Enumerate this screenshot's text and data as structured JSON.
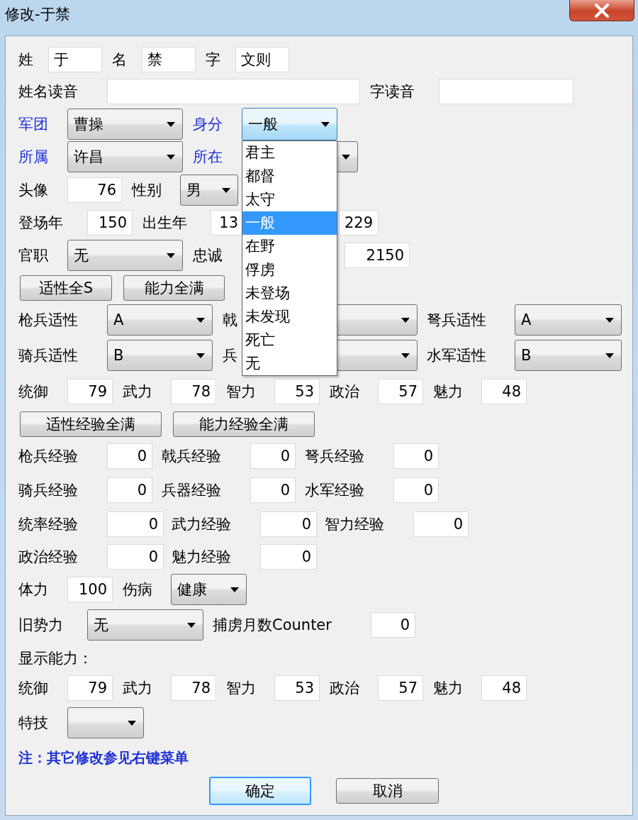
{
  "window": {
    "title": "修改-于禁"
  },
  "rows": [
    {
      "items": [
        {
          "kind": "label",
          "text": "姓"
        },
        {
          "kind": "text",
          "value": "于"
        },
        {
          "kind": "label",
          "text": "名"
        },
        {
          "kind": "text",
          "value": "禁"
        },
        {
          "kind": "label",
          "text": "字"
        },
        {
          "kind": "text",
          "value": "文则"
        }
      ]
    },
    {
      "items": [
        {
          "kind": "label",
          "text": "姓名读音"
        },
        {
          "kind": "text"
        },
        {
          "kind": "label",
          "text": "字读音"
        },
        {
          "kind": "text"
        }
      ]
    },
    {
      "items": [
        {
          "kind": "link",
          "text": "军团"
        },
        {
          "kind": "combo",
          "value": "曹操",
          "open": false
        },
        {
          "kind": "link",
          "text": "身分"
        },
        {
          "kind": "combo",
          "value": "一般",
          "open": true,
          "options": [
            {
              "text": "君主",
              "selected": false
            },
            {
              "text": "都督",
              "selected": false
            },
            {
              "text": "太守",
              "selected": false
            },
            {
              "text": "一般",
              "selected": true
            },
            {
              "text": "在野",
              "selected": false
            },
            {
              "text": "俘虏",
              "selected": false
            },
            {
              "text": "未登场",
              "selected": false
            },
            {
              "text": "未发现",
              "selected": false
            },
            {
              "text": "死亡",
              "selected": false
            },
            {
              "text": "无",
              "selected": false
            }
          ]
        }
      ]
    },
    {
      "items": [
        {
          "kind": "link",
          "text": "所属"
        },
        {
          "kind": "combo",
          "value": "许昌",
          "open": false
        },
        {
          "kind": "link",
          "text": "所在"
        },
        {
          "kind": "combo",
          "open": false
        }
      ]
    },
    {
      "items": [
        {
          "kind": "label",
          "text": "头像"
        },
        {
          "kind": "number",
          "value": "76"
        },
        {
          "kind": "label",
          "text": "性别"
        },
        {
          "kind": "combo",
          "value": "男",
          "open": false
        }
      ]
    },
    {
      "items": [
        {
          "kind": "label",
          "text": "登场年"
        },
        {
          "kind": "number",
          "value": "150"
        },
        {
          "kind": "label",
          "text": "出生年"
        },
        {
          "kind": "number",
          "value": "13"
        },
        {
          "kind": "number",
          "value": "229"
        }
      ]
    },
    {
      "items": [
        {
          "kind": "label",
          "text": "官职"
        },
        {
          "kind": "combo",
          "value": "无",
          "open": false
        },
        {
          "kind": "label",
          "text": "忠诚"
        },
        {
          "kind": "number",
          "value": "2150"
        }
      ]
    },
    {
      "items": [
        {
          "kind": "button",
          "text": "适性全S"
        },
        {
          "kind": "button",
          "text": "能力全满"
        }
      ]
    },
    {
      "items": [
        {
          "kind": "label",
          "text": "枪兵适性"
        },
        {
          "kind": "combo",
          "value": "A",
          "open": false
        },
        {
          "kind": "label",
          "text": "戟"
        },
        {
          "kind": "combo",
          "open": false
        },
        {
          "kind": "label",
          "text": "弩兵适性"
        },
        {
          "kind": "combo",
          "value": "A",
          "open": false
        }
      ]
    },
    {
      "items": [
        {
          "kind": "label",
          "text": "骑兵适性"
        },
        {
          "kind": "combo",
          "value": "B",
          "open": false
        },
        {
          "kind": "label",
          "text": "兵"
        },
        {
          "kind": "combo",
          "open": false
        },
        {
          "kind": "label",
          "text": "水军适性"
        },
        {
          "kind": "combo",
          "value": "B",
          "open": false
        }
      ]
    },
    {
      "items": [
        {
          "kind": "label",
          "text": "统御"
        },
        {
          "kind": "number",
          "value": "79"
        },
        {
          "kind": "label",
          "text": "武力"
        },
        {
          "kind": "number",
          "value": "78"
        },
        {
          "kind": "label",
          "text": "智力"
        },
        {
          "kind": "number",
          "value": "53"
        },
        {
          "kind": "label",
          "text": "政治"
        },
        {
          "kind": "number",
          "value": "57"
        },
        {
          "kind": "label",
          "text": "魅力"
        },
        {
          "kind": "number",
          "value": "48"
        }
      ]
    },
    {
      "items": [
        {
          "kind": "button",
          "text": "适性经验全满"
        },
        {
          "kind": "button",
          "text": "能力经验全满"
        }
      ]
    },
    {
      "items": [
        {
          "kind": "label",
          "text": "枪兵经验"
        },
        {
          "kind": "number",
          "value": "0"
        },
        {
          "kind": "label",
          "text": "戟兵经验"
        },
        {
          "kind": "number",
          "value": "0"
        },
        {
          "kind": "label",
          "text": "弩兵经验"
        },
        {
          "kind": "number",
          "value": "0"
        }
      ]
    },
    {
      "items": [
        {
          "kind": "label",
          "text": "骑兵经验"
        },
        {
          "kind": "number",
          "value": "0"
        },
        {
          "kind": "label",
          "text": "兵器经验"
        },
        {
          "kind": "number",
          "value": "0"
        },
        {
          "kind": "label",
          "text": "水军经验"
        },
        {
          "kind": "number",
          "value": "0"
        }
      ]
    },
    {
      "items": [
        {
          "kind": "label",
          "text": "统率经验"
        },
        {
          "kind": "number",
          "value": "0"
        },
        {
          "kind": "label",
          "text": "武力经验"
        },
        {
          "kind": "number",
          "value": "0"
        },
        {
          "kind": "label",
          "text": "智力经验"
        },
        {
          "kind": "number",
          "value": "0"
        }
      ]
    },
    {
      "items": [
        {
          "kind": "label",
          "text": "政治经验"
        },
        {
          "kind": "number",
          "value": "0"
        },
        {
          "kind": "label",
          "text": "魅力经验"
        },
        {
          "kind": "number",
          "value": "0"
        }
      ]
    },
    {
      "items": [
        {
          "kind": "label",
          "text": "体力"
        },
        {
          "kind": "number",
          "value": "100"
        },
        {
          "kind": "label",
          "text": "伤病"
        },
        {
          "kind": "combo",
          "value": "健康",
          "open": false
        }
      ]
    },
    {
      "items": [
        {
          "kind": "label",
          "text": "旧势力"
        },
        {
          "kind": "combo",
          "value": "无",
          "open": false
        },
        {
          "kind": "label",
          "text": "捕虏月数Counter"
        },
        {
          "kind": "number",
          "value": "0"
        }
      ]
    },
    {
      "items": [
        {
          "kind": "label",
          "text": "显示能力："
        }
      ]
    },
    {
      "items": [
        {
          "kind": "label",
          "text": "统御"
        },
        {
          "kind": "number",
          "value": "79"
        },
        {
          "kind": "label",
          "text": "武力"
        },
        {
          "kind": "number",
          "value": "78"
        },
        {
          "kind": "label",
          "text": "智力"
        },
        {
          "kind": "number",
          "value": "53"
        },
        {
          "kind": "label",
          "text": "政治"
        },
        {
          "kind": "number",
          "value": "57"
        },
        {
          "kind": "label",
          "text": "魅力"
        },
        {
          "kind": "number",
          "value": "48"
        }
      ]
    },
    {
      "items": [
        {
          "kind": "label",
          "text": "特技"
        },
        {
          "kind": "combo",
          "open": false
        }
      ]
    },
    {
      "items": [
        {
          "kind": "note",
          "text": "注：其它修改参见右键菜单"
        }
      ]
    },
    {
      "items": [
        {
          "kind": "default-button",
          "text": "确定"
        },
        {
          "kind": "button",
          "text": "取消"
        }
      ]
    }
  ]
}
